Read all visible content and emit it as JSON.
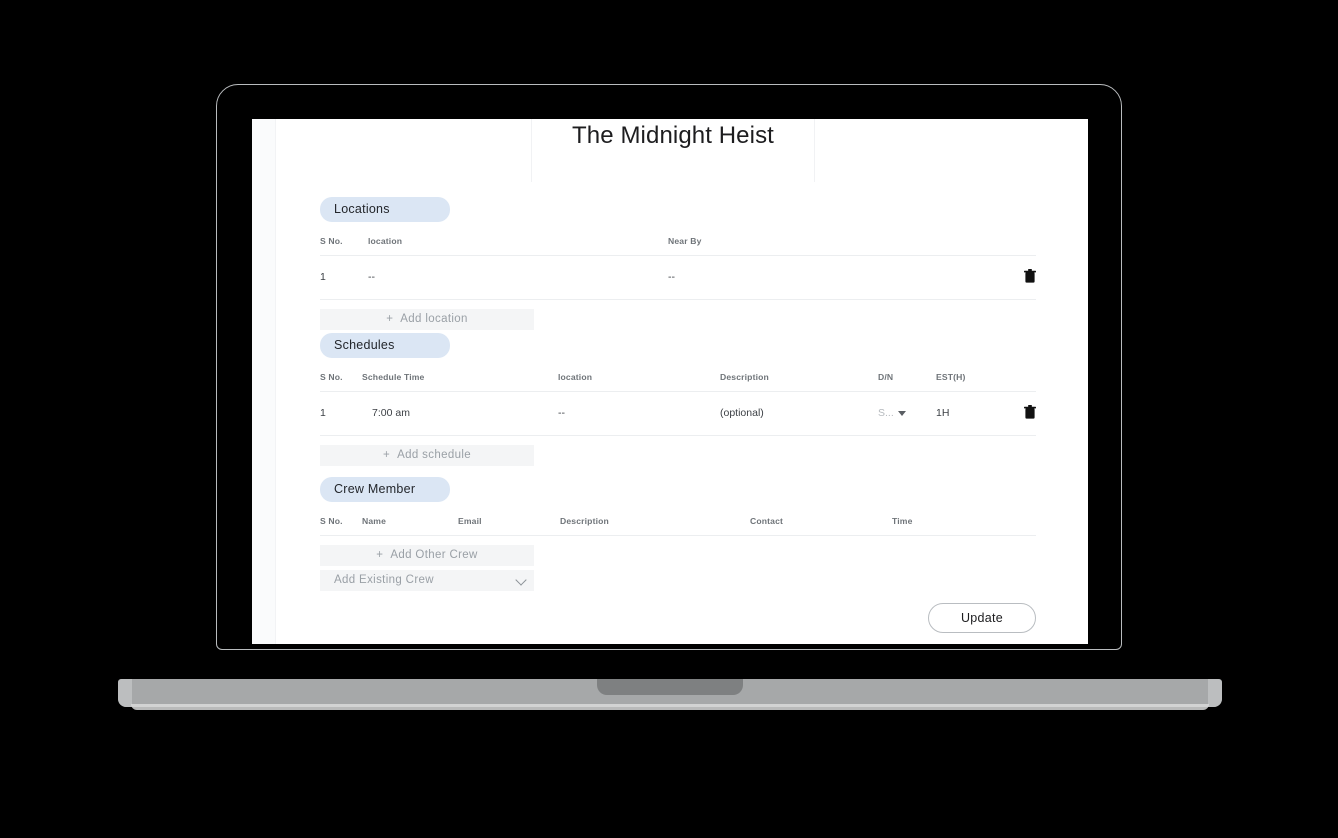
{
  "header": {
    "title": "The Midnight Heist"
  },
  "locations": {
    "pill_label": "Locations",
    "columns": [
      "S No.",
      "location",
      "Near By",
      ""
    ],
    "rows": [
      {
        "sno": "1",
        "location": "--",
        "nearby": "--",
        "delete_icon": "trash-icon"
      }
    ],
    "add_button": {
      "plus": "+",
      "label": "Add location"
    }
  },
  "schedules": {
    "pill_label": "Schedules",
    "columns": [
      "S No.",
      "Schedule Time",
      "location",
      "Description",
      "D/N",
      "EST(H)",
      ""
    ],
    "rows": [
      {
        "sno": "1",
        "time": "7:00 am",
        "location": "--",
        "description": "(optional)",
        "dn": "S...",
        "est": "1H",
        "delete_icon": "trash-icon"
      }
    ],
    "add_button": {
      "plus": "+",
      "label": "Add schedule"
    }
  },
  "crew": {
    "pill_label": "Crew Member",
    "columns": [
      "S No.",
      "Name",
      "Email",
      "Description",
      "Contact",
      "Time"
    ],
    "rows": [],
    "add_button": {
      "plus": "+",
      "label": "Add Other Crew"
    },
    "existing_select": {
      "label": "Add Existing Crew",
      "icon": "chevron-down-icon"
    }
  },
  "footer": {
    "update_label": "Update"
  },
  "colors": {
    "pill_bg": "#dbe6f4",
    "add_bar_bg": "#f4f5f6",
    "muted_text": "#b4b8bc",
    "header_text": "#6f7479",
    "device_frame": "#b9bcbe",
    "device_base": "#a6a8a9"
  }
}
